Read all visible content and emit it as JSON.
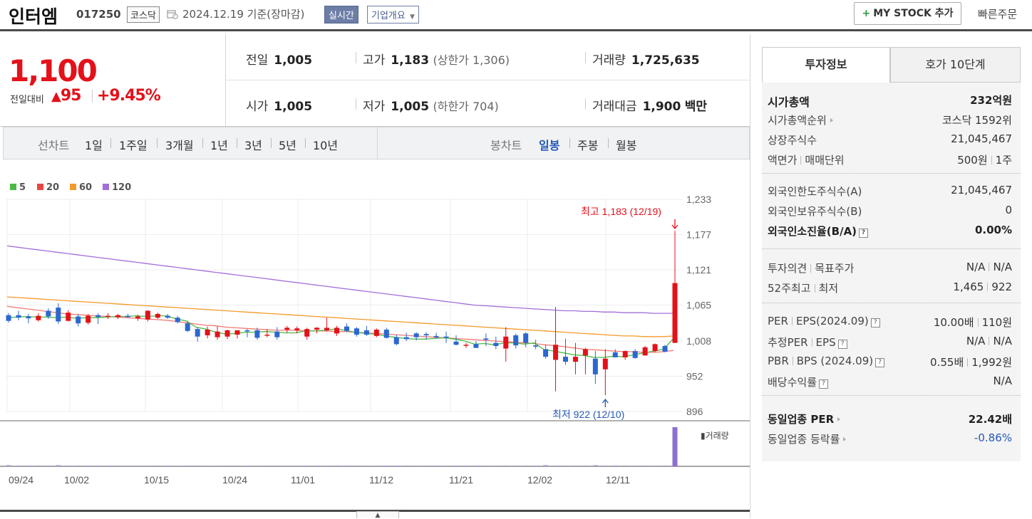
{
  "header": {
    "stock_name": "인터엠",
    "stock_code": "017250",
    "market": "코스닥",
    "basis_date": "2024.12.19 기준(장마감)",
    "realtime_label": "실시간",
    "company_overview_label": "기업개요",
    "my_stock_label": "MY STOCK 추가",
    "quick_order_label": "빠른주문"
  },
  "price": {
    "current": "1,100",
    "change_label": "전일대비",
    "change_amount": "95",
    "change_rate": "+9.45%",
    "prev_close_label": "전일",
    "prev_close": "1,005",
    "open_label": "시가",
    "open": "1,005",
    "high_label": "고가",
    "high": "1,183",
    "upper_limit": "(상한가 1,306)",
    "low_label": "저가",
    "low": "1,005",
    "lower_limit": "(하한가 704)",
    "volume_label": "거래량",
    "volume": "1,725,635",
    "trade_value_label": "거래대금",
    "trade_value": "1,900",
    "trade_value_unit": "백만"
  },
  "period_bar": {
    "line_chart_label": "선차트",
    "line_periods": [
      "1일",
      "1주일",
      "3개월",
      "1년",
      "3년",
      "5년",
      "10년"
    ],
    "candle_chart_label": "봉차트",
    "candle_periods": [
      "일봉",
      "주봉",
      "월봉"
    ],
    "active_candle": "일봉"
  },
  "chart_data": {
    "type": "candlestick",
    "legend": [
      {
        "name": "5",
        "color": "#4cb944"
      },
      {
        "name": "20",
        "color": "#e8473f"
      },
      {
        "name": "60",
        "color": "#f39a2b"
      },
      {
        "name": "120",
        "color": "#a26fd8"
      }
    ],
    "y_ticks": [
      1233,
      1177,
      1121,
      1065,
      1008,
      952,
      896
    ],
    "ylim": [
      896,
      1233
    ],
    "x_labels": [
      "09/24",
      "10/02",
      "10/15",
      "10/24",
      "11/01",
      "11/12",
      "11/21",
      "12/02",
      "12/11"
    ],
    "max_annotation": "최고 1,183 (12/19)",
    "min_annotation": "최저 922 (12/10)",
    "volume_label": "거래량",
    "up_color": "#e4111a",
    "down_color": "#2b67d1",
    "candles": [
      {
        "date": "09/24",
        "o": 1049,
        "h": 1052,
        "l": 1037,
        "c": 1040
      },
      {
        "date": "09/25",
        "o": 1049,
        "h": 1056,
        "l": 1041,
        "c": 1045
      },
      {
        "date": "09/26",
        "o": 1047,
        "h": 1051,
        "l": 1036,
        "c": 1044
      },
      {
        "date": "09/27",
        "o": 1041,
        "h": 1052,
        "l": 1039,
        "c": 1048
      },
      {
        "date": "09/30",
        "o": 1056,
        "h": 1060,
        "l": 1043,
        "c": 1047
      },
      {
        "date": "10/01",
        "o": 1061,
        "h": 1068,
        "l": 1035,
        "c": 1039
      },
      {
        "date": "10/02",
        "o": 1040,
        "h": 1057,
        "l": 1039,
        "c": 1053
      },
      {
        "date": "10/04",
        "o": 1047,
        "h": 1051,
        "l": 1031,
        "c": 1036
      },
      {
        "date": "10/07",
        "o": 1037,
        "h": 1051,
        "l": 1034,
        "c": 1048
      },
      {
        "date": "10/08",
        "o": 1049,
        "h": 1052,
        "l": 1035,
        "c": 1046
      },
      {
        "date": "10/10",
        "o": 1047,
        "h": 1052,
        "l": 1043,
        "c": 1048
      },
      {
        "date": "10/11",
        "o": 1046,
        "h": 1051,
        "l": 1043,
        "c": 1049
      },
      {
        "date": "10/14",
        "o": 1048,
        "h": 1051,
        "l": 1045,
        "c": 1046
      },
      {
        "date": "10/15",
        "o": 1044,
        "h": 1050,
        "l": 1040,
        "c": 1047
      },
      {
        "date": "10/16",
        "o": 1042,
        "h": 1057,
        "l": 1039,
        "c": 1056
      },
      {
        "date": "10/17",
        "o": 1045,
        "h": 1053,
        "l": 1043,
        "c": 1051
      },
      {
        "date": "10/18",
        "o": 1048,
        "h": 1051,
        "l": 1043,
        "c": 1045
      },
      {
        "date": "10/21",
        "o": 1045,
        "h": 1048,
        "l": 1036,
        "c": 1038
      },
      {
        "date": "10/22",
        "o": 1036,
        "h": 1040,
        "l": 1022,
        "c": 1024
      },
      {
        "date": "10/23",
        "o": 1027,
        "h": 1030,
        "l": 1007,
        "c": 1015
      },
      {
        "date": "10/24",
        "o": 1017,
        "h": 1031,
        "l": 1012,
        "c": 1026
      },
      {
        "date": "10/25",
        "o": 1014,
        "h": 1031,
        "l": 1010,
        "c": 1023
      },
      {
        "date": "10/28",
        "o": 1015,
        "h": 1026,
        "l": 1011,
        "c": 1025
      },
      {
        "date": "10/29",
        "o": 1018,
        "h": 1024,
        "l": 1012,
        "c": 1025
      },
      {
        "date": "10/30",
        "o": 1025,
        "h": 1027,
        "l": 1014,
        "c": 1024
      },
      {
        "date": "10/31",
        "o": 1025,
        "h": 1029,
        "l": 1010,
        "c": 1013
      },
      {
        "date": "11/01",
        "o": 1017,
        "h": 1027,
        "l": 1014,
        "c": 1018
      },
      {
        "date": "11/04",
        "o": 1023,
        "h": 1030,
        "l": 1010,
        "c": 1014
      },
      {
        "date": "11/05",
        "o": 1026,
        "h": 1032,
        "l": 1021,
        "c": 1029
      },
      {
        "date": "11/06",
        "o": 1025,
        "h": 1031,
        "l": 1020,
        "c": 1028
      },
      {
        "date": "11/07",
        "o": 1015,
        "h": 1029,
        "l": 1010,
        "c": 1027
      },
      {
        "date": "11/08",
        "o": 1026,
        "h": 1030,
        "l": 1020,
        "c": 1029
      },
      {
        "date": "11/11",
        "o": 1025,
        "h": 1045,
        "l": 1023,
        "c": 1029
      },
      {
        "date": "11/12",
        "o": 1020,
        "h": 1032,
        "l": 1016,
        "c": 1029
      },
      {
        "date": "11/13",
        "o": 1031,
        "h": 1036,
        "l": 1022,
        "c": 1024
      },
      {
        "date": "11/14",
        "o": 1028,
        "h": 1030,
        "l": 1015,
        "c": 1018
      },
      {
        "date": "11/15",
        "o": 1025,
        "h": 1032,
        "l": 1016,
        "c": 1018
      },
      {
        "date": "11/18",
        "o": 1016,
        "h": 1028,
        "l": 1014,
        "c": 1026
      },
      {
        "date": "11/19",
        "o": 1026,
        "h": 1029,
        "l": 1012,
        "c": 1013
      },
      {
        "date": "11/20",
        "o": 1014,
        "h": 1018,
        "l": 1001,
        "c": 1003
      },
      {
        "date": "11/21",
        "o": 1014,
        "h": 1021,
        "l": 1008,
        "c": 1011
      },
      {
        "date": "11/22",
        "o": 1020,
        "h": 1022,
        "l": 1009,
        "c": 1014
      },
      {
        "date": "11/25",
        "o": 1019,
        "h": 1022,
        "l": 1010,
        "c": 1017
      },
      {
        "date": "11/26",
        "o": 1016,
        "h": 1021,
        "l": 1012,
        "c": 1014
      },
      {
        "date": "11/27",
        "o": 1015,
        "h": 1023,
        "l": 1005,
        "c": 1013
      },
      {
        "date": "11/28",
        "o": 1007,
        "h": 1017,
        "l": 1001,
        "c": 1002
      },
      {
        "date": "11/29",
        "o": 1002,
        "h": 1005,
        "l": 997,
        "c": 1002
      },
      {
        "date": "12/02",
        "o": 1003,
        "h": 1008,
        "l": 997,
        "c": 997
      },
      {
        "date": "12/03",
        "o": 1012,
        "h": 1020,
        "l": 1000,
        "c": 1010
      },
      {
        "date": "12/04",
        "o": 1005,
        "h": 1015,
        "l": 995,
        "c": 1000
      },
      {
        "date": "12/05",
        "o": 996,
        "h": 1030,
        "l": 975,
        "c": 1015
      },
      {
        "date": "12/06",
        "o": 1017,
        "h": 1020,
        "l": 996,
        "c": 1001
      },
      {
        "date": "12/09",
        "o": 1020,
        "h": 1022,
        "l": 998,
        "c": 1005
      },
      {
        "date": "12/09b",
        "o": 1001,
        "h": 1010,
        "l": 995,
        "c": 999
      },
      {
        "date": "12/10",
        "o": 995,
        "h": 1002,
        "l": 980,
        "c": 983
      },
      {
        "date": "12/10b",
        "o": 978,
        "h": 1062,
        "l": 928,
        "c": 1002
      },
      {
        "date": "12/11",
        "o": 983,
        "h": 1012,
        "l": 970,
        "c": 975
      },
      {
        "date": "12/12",
        "o": 975,
        "h": 1005,
        "l": 955,
        "c": 983
      },
      {
        "date": "12/13",
        "o": 985,
        "h": 997,
        "l": 955,
        "c": 995
      },
      {
        "date": "12/13b",
        "o": 980,
        "h": 992,
        "l": 940,
        "c": 955
      },
      {
        "date": "12/16",
        "o": 963,
        "h": 995,
        "l": 922,
        "c": 980
      },
      {
        "date": "12/16b",
        "o": 990,
        "h": 995,
        "l": 982,
        "c": 982
      },
      {
        "date": "12/17",
        "o": 982,
        "h": 993,
        "l": 978,
        "c": 992
      },
      {
        "date": "12/17b",
        "o": 992,
        "h": 995,
        "l": 980,
        "c": 981
      },
      {
        "date": "12/18",
        "o": 985,
        "h": 1000,
        "l": 985,
        "c": 998
      },
      {
        "date": "12/18b",
        "o": 992,
        "h": 1004,
        "l": 990,
        "c": 1003
      },
      {
        "date": "12/18c",
        "o": 1000,
        "h": 1002,
        "l": 990,
        "c": 991
      },
      {
        "date": "12/19",
        "o": 1005,
        "h": 1183,
        "l": 1005,
        "c": 1100
      }
    ],
    "ma5": [
      1045,
      1046,
      1047,
      1046,
      1046,
      1045,
      1046,
      1044,
      1045,
      1045,
      1046,
      1047,
      1047,
      1048,
      1047,
      1048,
      1048,
      1043,
      1040,
      1030,
      1027,
      1022,
      1019,
      1020,
      1022,
      1022,
      1023,
      1022,
      1021,
      1021,
      1024,
      1024,
      1025,
      1027,
      1025,
      1022,
      1020,
      1019,
      1016,
      1014,
      1012,
      1011,
      1011,
      1012,
      1013,
      1011,
      1008,
      1003,
      1004,
      1002,
      1005,
      1005,
      1003,
      1005,
      994,
      992,
      989,
      986,
      985,
      982,
      982,
      984,
      983,
      986,
      989,
      992,
      995,
      1012
    ],
    "ma20": [
      1063,
      1061,
      1059,
      1057,
      1055,
      1053,
      1051,
      1050,
      1049,
      1048,
      1047,
      1046,
      1045,
      1044,
      1043,
      1042,
      1041,
      1039,
      1037,
      1035,
      1033,
      1032,
      1030,
      1029,
      1028,
      1027,
      1026,
      1025,
      1025,
      1025,
      1024,
      1024,
      1024,
      1023,
      1023,
      1022,
      1021,
      1020,
      1019,
      1018,
      1017,
      1016,
      1015,
      1014,
      1013,
      1012,
      1011,
      1010,
      1009,
      1008,
      1007,
      1006,
      1005,
      1004,
      1002,
      1001,
      999,
      997,
      995,
      994,
      993,
      992,
      991,
      991,
      990,
      990,
      991,
      993
    ],
    "ma60": [
      1078,
      1077,
      1076,
      1075,
      1074,
      1073,
      1072,
      1071,
      1070,
      1069,
      1068,
      1067,
      1066,
      1065,
      1064,
      1063,
      1062,
      1061,
      1060,
      1059,
      1058,
      1057,
      1056,
      1055,
      1054,
      1053,
      1052,
      1051,
      1050,
      1049,
      1048,
      1047,
      1046,
      1045,
      1044,
      1043,
      1042,
      1041,
      1040,
      1039,
      1038,
      1037,
      1036,
      1035,
      1034,
      1033,
      1032,
      1031,
      1030,
      1029,
      1028,
      1027,
      1026,
      1025,
      1024,
      1023,
      1022,
      1021,
      1020,
      1019,
      1018,
      1017,
      1016,
      1016,
      1015,
      1015,
      1015,
      1016
    ],
    "ma120": [
      1159,
      1157,
      1155,
      1153,
      1151,
      1149,
      1147,
      1145,
      1143,
      1141,
      1139,
      1137,
      1135,
      1133,
      1131,
      1129,
      1127,
      1125,
      1123,
      1121,
      1119,
      1117,
      1115,
      1113,
      1111,
      1109,
      1107,
      1105,
      1103,
      1101,
      1099,
      1097,
      1095,
      1093,
      1091,
      1089,
      1087,
      1085,
      1083,
      1081,
      1079,
      1077,
      1075,
      1073,
      1071,
      1069,
      1067,
      1065,
      1064,
      1063,
      1062,
      1061,
      1060,
      1059,
      1058,
      1057,
      1056,
      1056,
      1055,
      1055,
      1054,
      1054,
      1053,
      1053,
      1053,
      1052,
      1052,
      1052
    ],
    "volume": [
      3,
      2,
      2,
      2,
      1,
      3,
      2,
      2,
      2,
      1,
      1,
      1,
      1,
      1,
      1,
      2,
      1,
      1,
      2,
      2,
      1,
      1,
      1,
      1,
      1,
      1,
      1,
      1,
      1,
      1,
      1,
      1,
      1,
      2,
      2,
      1,
      1,
      1,
      1,
      1,
      2,
      1,
      1,
      1,
      1,
      2,
      1,
      2,
      1,
      1,
      2,
      2,
      2,
      2,
      3,
      2,
      2,
      2,
      2,
      3,
      2,
      2,
      2,
      1,
      2,
      1,
      2,
      100
    ]
  },
  "right_panel": {
    "tabs": [
      "투자정보",
      "호가 10단계"
    ],
    "market_cap_label": "시가총액",
    "market_cap": "232억원",
    "market_cap_rank_label": "시가총액순위",
    "market_cap_rank": "코스닥 1592위",
    "shares_label": "상장주식수",
    "shares": "21,045,467",
    "par_label": "액면가",
    "unit_label": "매매단위",
    "par": "500원",
    "unit": "1주",
    "foreign_limit_label": "외국인한도주식수(A)",
    "foreign_limit": "21,045,467",
    "foreign_hold_label": "외국인보유주식수(B)",
    "foreign_hold": "0",
    "foreign_rate_label": "외국인소진율(B/A)",
    "foreign_rate": "0.00%",
    "opinion_label": "투자의견",
    "target_label": "목표주가",
    "opinion": "N/A",
    "target": "N/A",
    "w52_high_label": "52주최고",
    "w52_low_label": "최저",
    "w52_high": "1,465",
    "w52_low": "922",
    "per_label": "PER",
    "eps_label": "EPS(2024.09)",
    "per": "10.00배",
    "eps": "110원",
    "est_per_label": "추정PER",
    "est_eps_label": "EPS",
    "est_per": "N/A",
    "est_eps": "N/A",
    "pbr_label": "PBR",
    "bps_label": "BPS (2024.09)",
    "pbr": "0.55배",
    "bps": "1,992원",
    "div_label": "배당수익률",
    "div": "N/A",
    "sector_per_label": "동일업종 PER",
    "sector_per": "22.42배",
    "sector_change_label": "동일업종 등락률",
    "sector_change": "-0.86%"
  }
}
